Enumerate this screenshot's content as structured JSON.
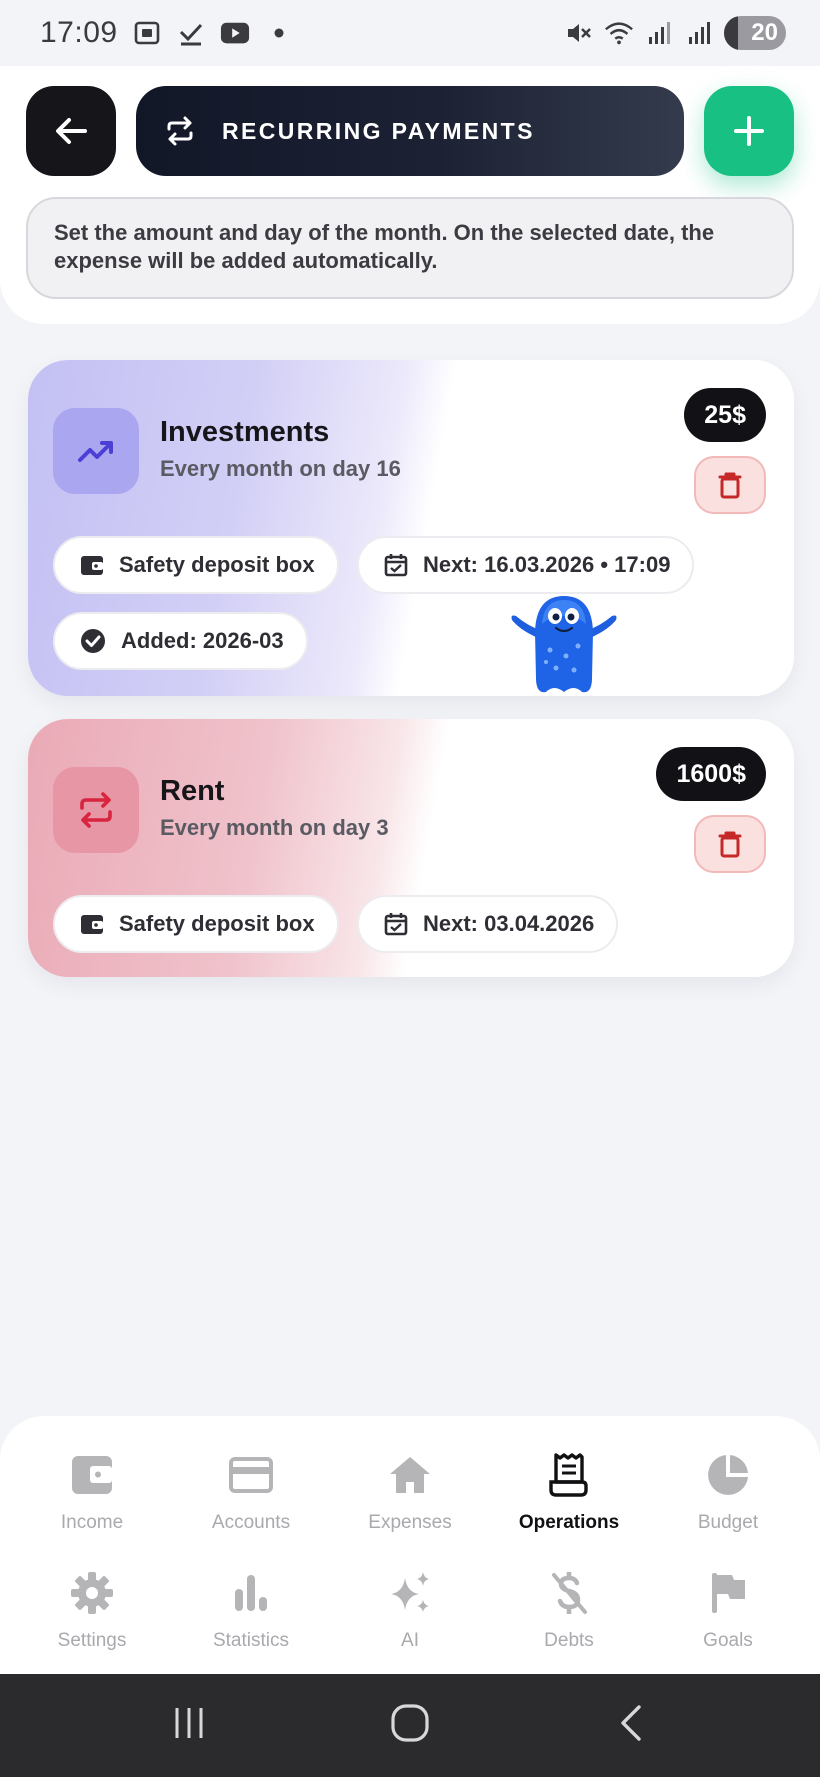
{
  "status_bar": {
    "time": "17:09",
    "battery": "20"
  },
  "header": {
    "title": "RECURRING PAYMENTS",
    "info": "Set the amount and day of the month. On the selected date, the expense will be added automatically."
  },
  "payments": [
    {
      "title": "Investments",
      "schedule": "Every month on day 16",
      "amount": "25$",
      "account": "Safety deposit box",
      "next": "Next: 16.03.2026 • 17:09",
      "added": "Added: 2026-03",
      "icon": "trending-up-icon",
      "accent": "#4b3fd6"
    },
    {
      "title": "Rent",
      "schedule": "Every month on day 3",
      "amount": "1600$",
      "account": "Safety deposit box",
      "next": "Next: 03.04.2026",
      "icon": "repeat-icon",
      "accent": "#d8243f"
    }
  ],
  "nav": {
    "income": "Income",
    "accounts": "Accounts",
    "expenses": "Expenses",
    "operations": "Operations",
    "budget": "Budget",
    "settings": "Settings",
    "statistics": "Statistics",
    "ai": "AI",
    "debts": "Debts",
    "goals": "Goals",
    "active": "operations"
  },
  "colors": {
    "add_button": "#18c183",
    "delete_icon": "#c62828",
    "nav_inactive": "#a9a9ae",
    "nav_active": "#111114"
  }
}
